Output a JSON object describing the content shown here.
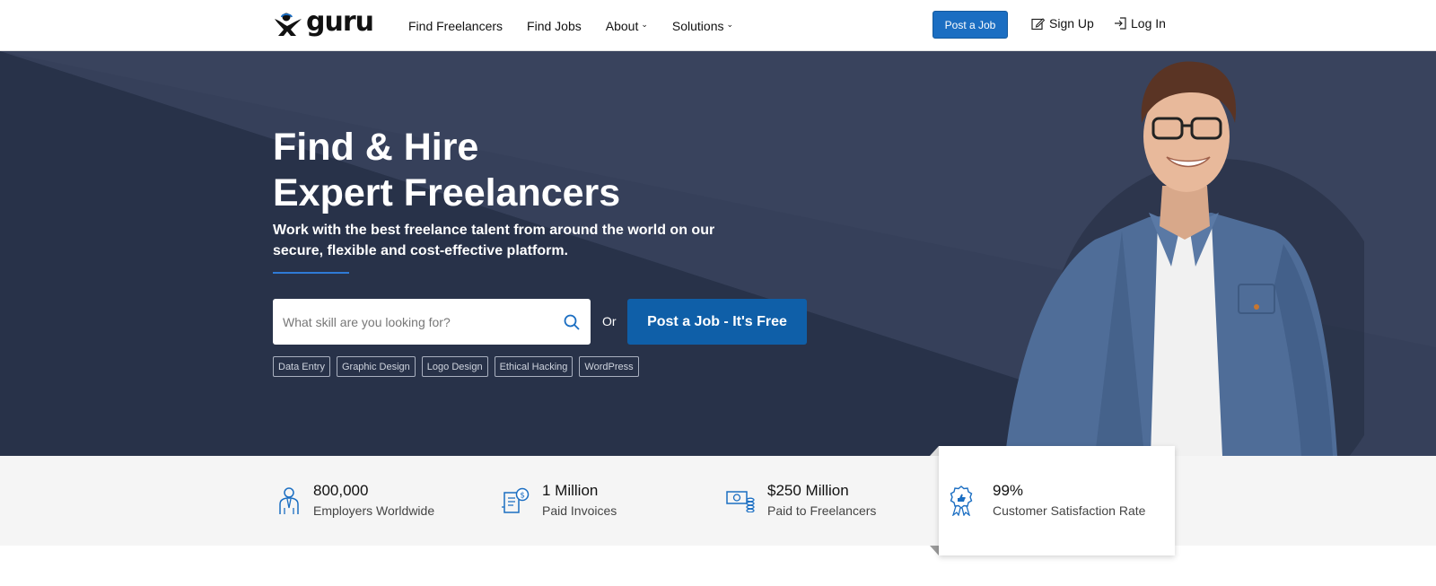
{
  "header": {
    "logo_text": "guru",
    "nav": [
      {
        "label": "Find Freelancers"
      },
      {
        "label": "Find Jobs"
      },
      {
        "label": "About"
      },
      {
        "label": "Solutions"
      }
    ],
    "post_job_label": "Post a Job",
    "sign_up_label": "Sign Up",
    "log_in_label": "Log In"
  },
  "hero": {
    "title_line1": "Find & Hire",
    "title_line2": "Expert Freelancers",
    "subtitle": "Work with the best freelance talent from around the world on our secure, flexible and cost-effective platform.",
    "search_placeholder": "What skill are you looking for?",
    "or_label": "Or",
    "post_job_cta": "Post a Job - It's Free",
    "tags": [
      "Data Entry",
      "Graphic Design",
      "Logo Design",
      "Ethical Hacking",
      "WordPress"
    ]
  },
  "stats": [
    {
      "number": "800,000",
      "label": "Employers Worldwide",
      "icon": "employer-icon"
    },
    {
      "number": "1 Million",
      "label": "Paid Invoices",
      "icon": "invoice-icon"
    },
    {
      "number": "$250 Million",
      "label": "Paid to Freelancers",
      "icon": "money-icon"
    },
    {
      "number": "99%",
      "label": "Customer Satisfaction Rate",
      "icon": "award-icon"
    }
  ],
  "colors": {
    "brand_blue": "#1b6ec2",
    "hero_bg": "#283249",
    "cta_blue": "#0f5fa8"
  }
}
